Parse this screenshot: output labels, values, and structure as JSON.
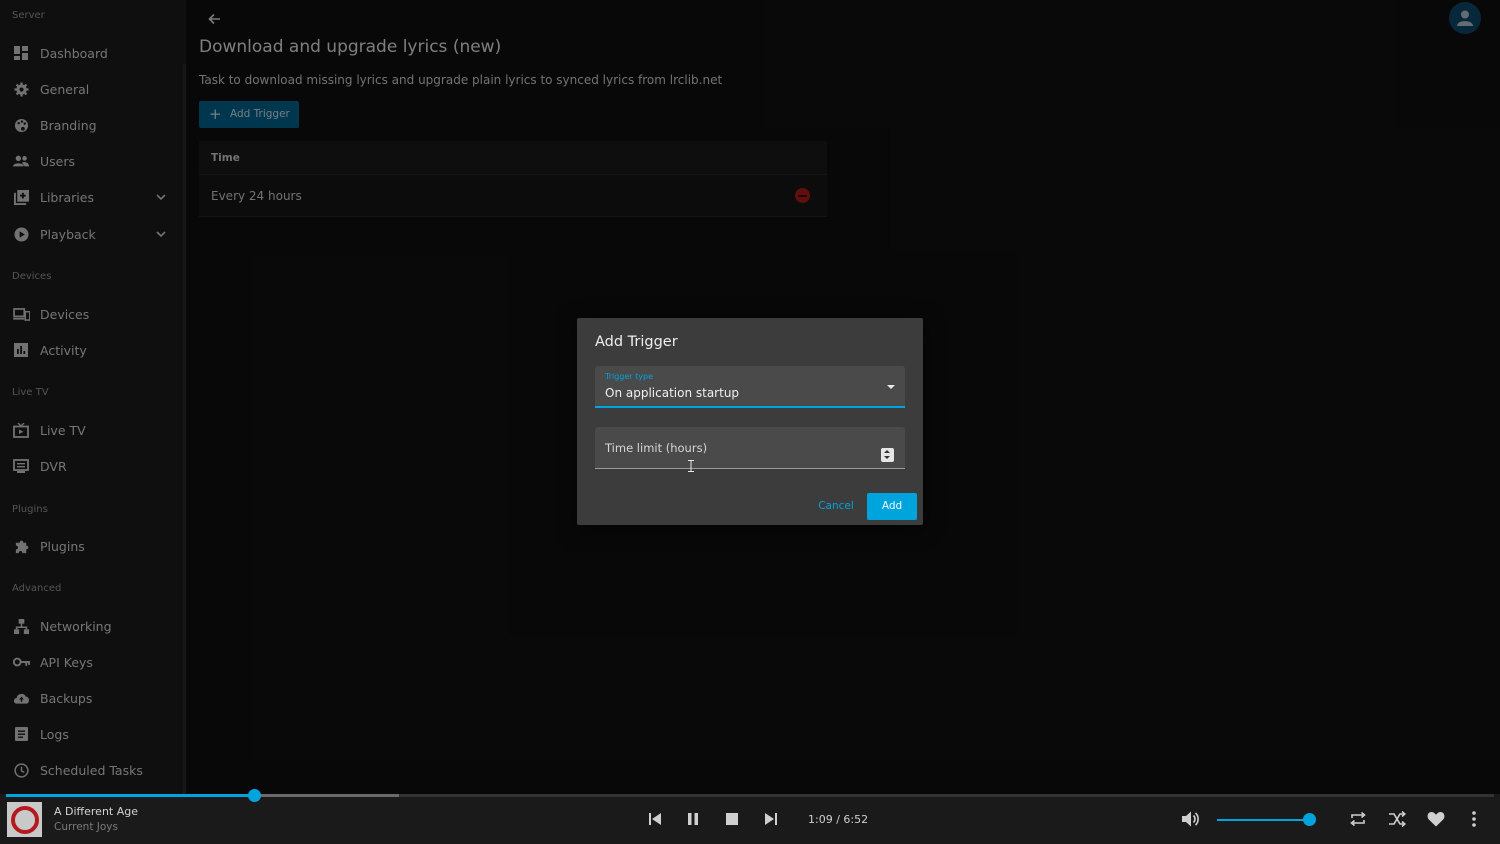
{
  "sidebar": {
    "sections": [
      {
        "header": "Server"
      },
      {
        "header": "Devices"
      },
      {
        "header": "Live TV"
      },
      {
        "header": "Plugins"
      },
      {
        "header": "Advanced"
      }
    ],
    "items": [
      {
        "label": "Dashboard",
        "icon": "dashboard-icon"
      },
      {
        "label": "General",
        "icon": "gear-icon"
      },
      {
        "label": "Branding",
        "icon": "palette-icon"
      },
      {
        "label": "Users",
        "icon": "people-icon"
      },
      {
        "label": "Libraries",
        "icon": "library-icon"
      },
      {
        "label": "Playback",
        "icon": "play-circle-icon"
      },
      {
        "label": "Devices",
        "icon": "devices-icon"
      },
      {
        "label": "Activity",
        "icon": "chart-icon"
      },
      {
        "label": "Live TV",
        "icon": "live-tv-icon"
      },
      {
        "label": "DVR",
        "icon": "dvr-icon"
      },
      {
        "label": "Plugins",
        "icon": "puzzle-icon"
      },
      {
        "label": "Networking",
        "icon": "network-icon"
      },
      {
        "label": "API Keys",
        "icon": "key-icon"
      },
      {
        "label": "Backups",
        "icon": "cloud-upload-icon"
      },
      {
        "label": "Logs",
        "icon": "logs-icon"
      },
      {
        "label": "Scheduled Tasks",
        "icon": "clock-icon"
      }
    ]
  },
  "page": {
    "title": "Download and upgrade lyrics (new)",
    "description": "Task to download missing lyrics and upgrade plain lyrics to synced lyrics from lrclib.net",
    "add_trigger_label": "Add Trigger",
    "table": {
      "header": "Time",
      "rows": [
        {
          "time": "Every 24 hours"
        }
      ]
    }
  },
  "dialog": {
    "title": "Add Trigger",
    "trigger_type_label": "Trigger type",
    "trigger_type_value": "On application startup",
    "time_limit_placeholder": "Time limit (hours)",
    "cancel_label": "Cancel",
    "add_label": "Add"
  },
  "player": {
    "track_title": "A Different Age",
    "artist": "Current Joys",
    "time": "1:09 / 6:52",
    "progress_fraction": 0.167,
    "volume_fraction": 1.0
  },
  "colors": {
    "accent": "#00a4dc",
    "delete": "#b01a1a",
    "button_primary": "#00658f"
  }
}
